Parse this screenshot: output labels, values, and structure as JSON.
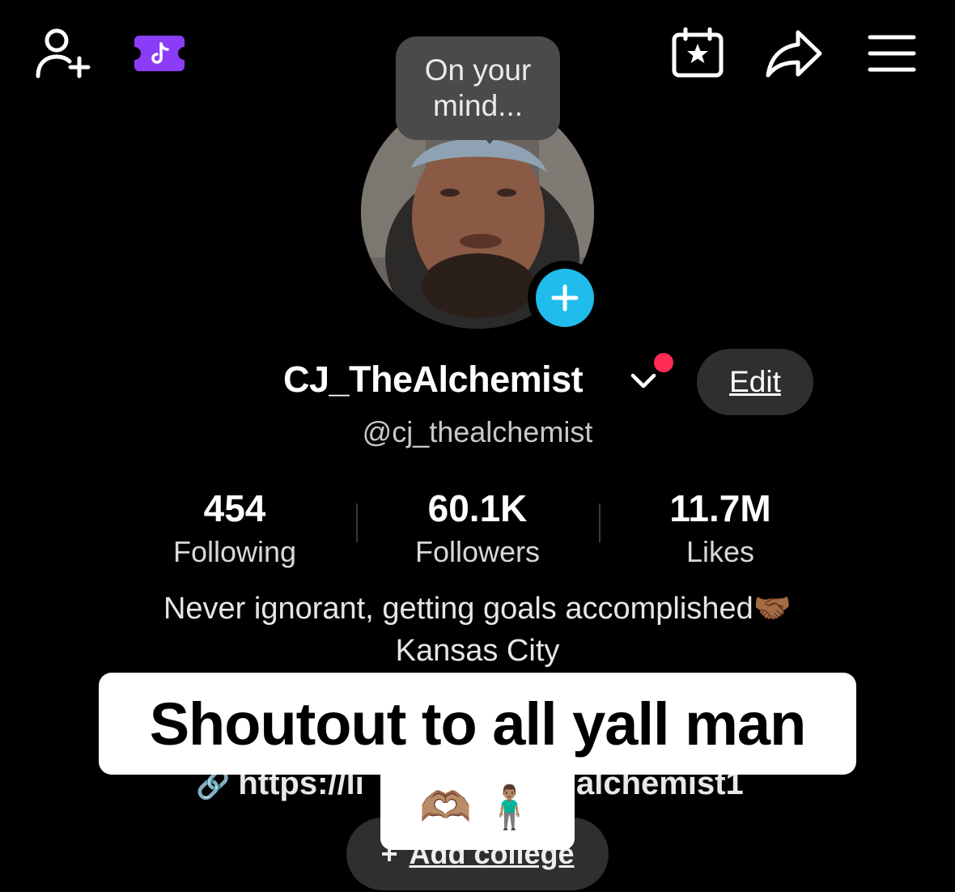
{
  "topbar": {
    "add_friend_icon": "person-add-icon",
    "promo_icon": "tiktok-ticket-icon",
    "calendar_icon": "calendar-star-icon",
    "share_icon": "share-arrow-icon",
    "menu_icon": "hamburger-menu-icon"
  },
  "bubble": {
    "line1": "On your",
    "line2": "mind..."
  },
  "profile": {
    "display_name": "CJ_TheAlchemist",
    "edit_label": "Edit",
    "handle": "@cj_thealchemist"
  },
  "stats": [
    {
      "value": "454",
      "label": "Following"
    },
    {
      "value": "60.1K",
      "label": "Followers"
    },
    {
      "value": "11.7M",
      "label": "Likes"
    }
  ],
  "bio": {
    "line1": "Never ignorant, getting goals accomplished🤝🏾",
    "line2": "Kansas City"
  },
  "link": {
    "prefix": "https://li",
    "suffix": "alchemist1"
  },
  "caption": {
    "text": "Shoutout to all yall man",
    "emojis": "🫶🏽 🧍🏽‍♂️"
  },
  "college": {
    "plus": "+",
    "label": "Add college"
  },
  "colors": {
    "background": "#000000",
    "accent_blue": "#20bdec",
    "notification_red": "#fe2c55",
    "promo_purple": "#8b3cf7",
    "button_gray": "#2f2f2f"
  }
}
